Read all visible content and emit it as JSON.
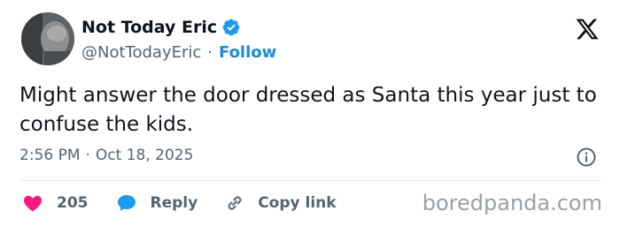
{
  "author": {
    "display_name": "Not Today Eric",
    "handle": "@NotTodayEric",
    "separator": "·",
    "follow_label": "Follow"
  },
  "tweet": {
    "text": "Might answer the door dressed as Santa this year just to confuse the kids.",
    "time": "2:56 PM",
    "date": "Oct 18, 2025",
    "meta_separator": "·"
  },
  "actions": {
    "like_count": "205",
    "reply_label": "Reply",
    "copy_link_label": "Copy link"
  },
  "watermark": "boredpanda.com",
  "colors": {
    "like": "#f91880",
    "reply": "#1d9bf0",
    "verified": "#1d9bf0",
    "follow": "#1d8bd6"
  },
  "icons": [
    "verified-badge-icon",
    "x-logo-icon",
    "info-icon",
    "heart-icon",
    "reply-bubble-icon",
    "link-icon"
  ]
}
